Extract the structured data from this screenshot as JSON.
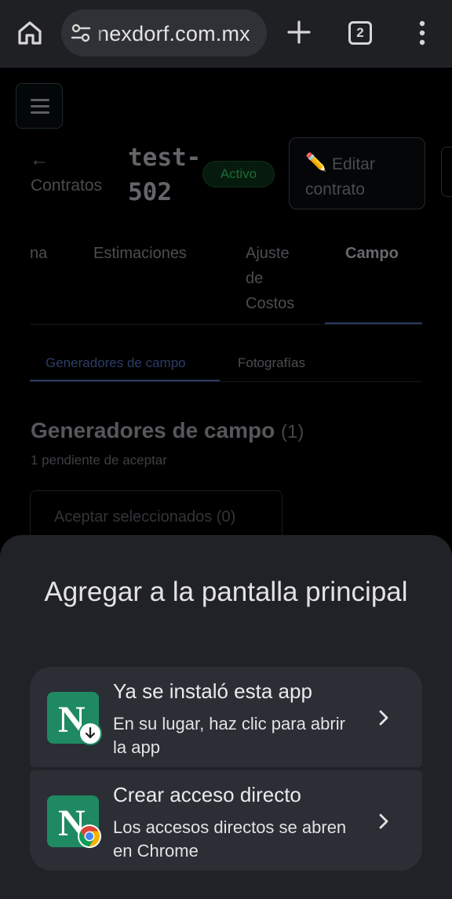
{
  "browser": {
    "url": "nexdorf.com.mx",
    "tab_count": "2"
  },
  "page": {
    "back_arrow": "←",
    "back_label": "Contratos",
    "title_line1": "test-",
    "title_line2": "502",
    "status": "Activo",
    "edit_icon": "✏️",
    "edit_label": "Editar contrato",
    "tabs": [
      {
        "label": "na"
      },
      {
        "label": "Estimaciones"
      },
      {
        "label": "Ajuste de Costos"
      },
      {
        "label": "Campo"
      }
    ],
    "subtabs": [
      {
        "label": "Generadores de campo"
      },
      {
        "label": "Fotografías"
      }
    ],
    "section_title": "Generadores de campo",
    "section_count": "(1)",
    "section_subtitle": "1 pendiente de aceptar",
    "accept_button": "Aceptar seleccionados (0)"
  },
  "sheet": {
    "title": "Agregar a la pantalla principal",
    "options": [
      {
        "title": "Ya se instaló esta app",
        "description": "En su lugar, haz clic para abrir la app",
        "icon_letter": "N",
        "badge": "download-arrow-icon"
      },
      {
        "title": "Crear acceso directo",
        "description": "Los accesos directos se abren en Chrome",
        "icon_letter": "N",
        "badge": "chrome-icon"
      }
    ]
  },
  "colors": {
    "sheet_bg": "#202227",
    "option_bg": "#2b2e34",
    "app_icon": "#1f8a62"
  }
}
